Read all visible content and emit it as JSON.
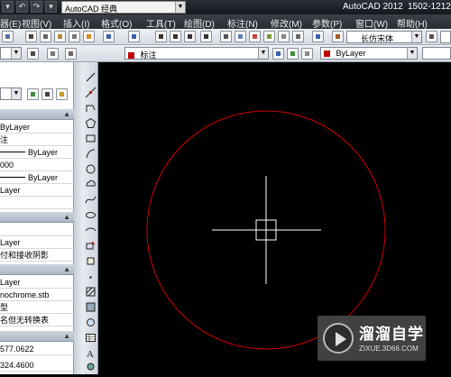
{
  "window": {
    "title": "AutoCAD 2012",
    "title_suffix": "1502-1212"
  },
  "workspace": {
    "value": "AutoCAD 经典"
  },
  "menu": [
    "器(E)",
    "视图(V)",
    "插入(I)",
    "格式(O)",
    "工具(T)",
    "绘图(D)",
    "标注(N)",
    "修改(M)",
    "参数(P)",
    "窗口(W)",
    "帮助(H)"
  ],
  "toolbar2": {
    "dim_style": "标注",
    "color": "ByLayer"
  },
  "text_style": {
    "font": "长仿宋体"
  },
  "properties": {
    "rows": [
      "ByLayer",
      "注",
      "ByLayer",
      "000",
      "ByLayer",
      "Layer",
      "Layer",
      "付和接收阴影",
      "Layer",
      "nochrome.stb",
      "型",
      "名但无转换表",
      "577.0622",
      "324.4600"
    ]
  },
  "watermark": {
    "name": "溜溜自学",
    "url": "ZIXUE.3D66.COM"
  },
  "colors": {
    "accent_red": "#c00000",
    "circle": "#d00000",
    "crosshair": "#ffffff"
  },
  "icons": [
    "line-icon",
    "xline-icon",
    "polyline-icon",
    "polygon-icon",
    "rectangle-icon",
    "arc-icon",
    "circle-icon",
    "revcloud-icon",
    "spline-icon",
    "ellipse-icon",
    "ellipse-arc-icon",
    "insert-block-icon",
    "make-block-icon",
    "point-icon",
    "hatch-icon",
    "gradient-icon",
    "region-icon",
    "table-icon",
    "mtext-icon",
    "add-selected-icon"
  ]
}
